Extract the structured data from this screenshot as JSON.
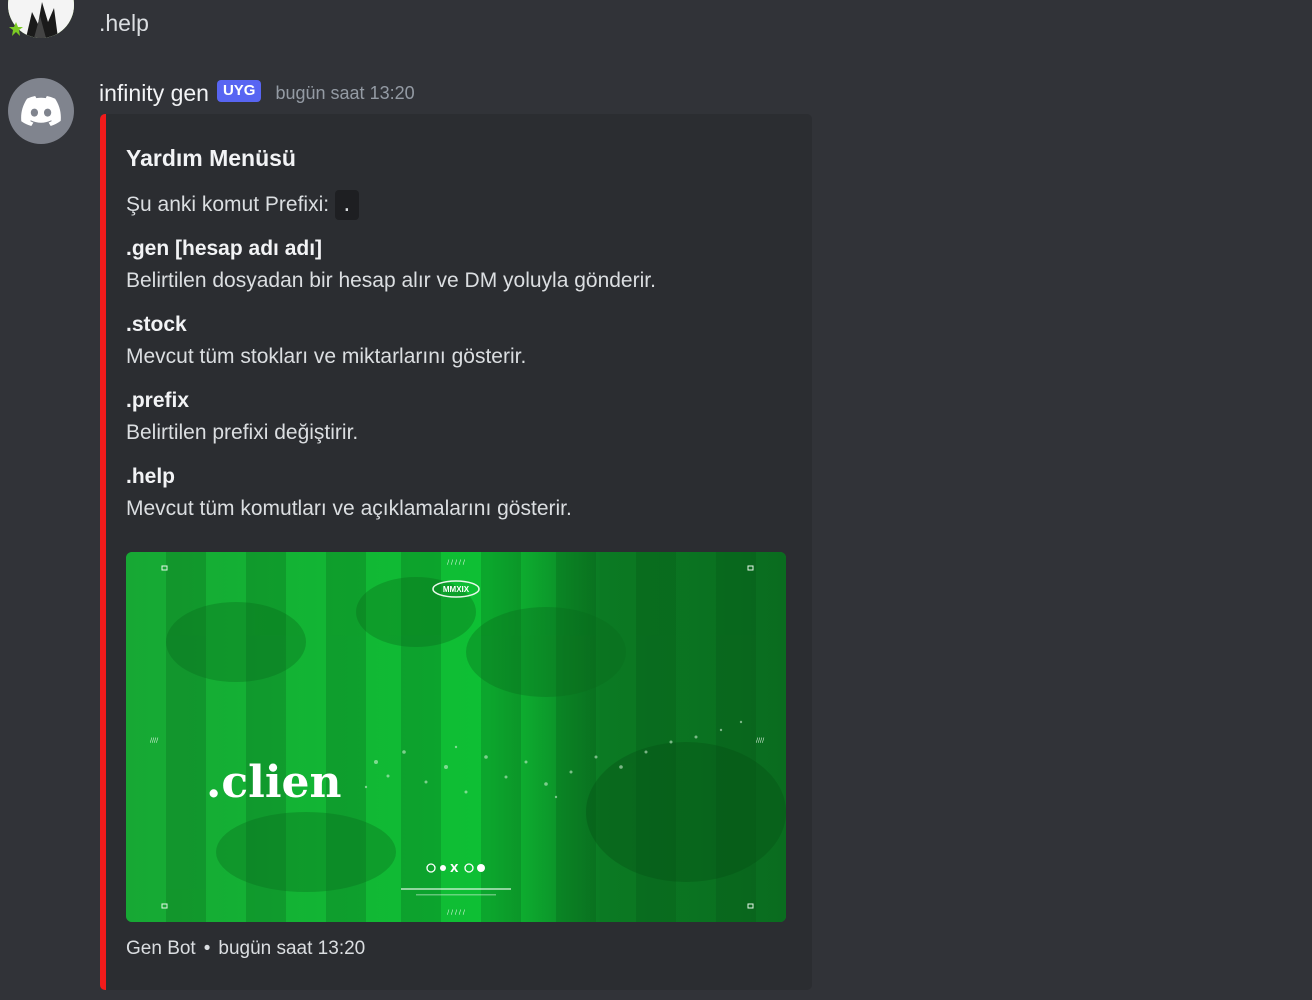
{
  "previous_message": {
    "text": ".help"
  },
  "message": {
    "author": "infinity gen",
    "badge": "UYG",
    "timestamp": "bugün saat 13:20"
  },
  "embed": {
    "accent_color": "#f21b1b",
    "title": "Yardım Menüsü",
    "description_label": "Şu anki komut Prefixi:",
    "prefix_code": ".",
    "fields": [
      {
        "name": ".gen [hesap adı adı]",
        "value": "Belirtilen dosyadan bir hesap alır ve DM yoluyla gönderir."
      },
      {
        "name": ".stock",
        "value": "Mevcut tüm stokları ve miktarlarını gösterir."
      },
      {
        "name": ".prefix",
        "value": "Belirtilen prefixi değiştirir."
      },
      {
        "name": ".help",
        "value": "Mevcut tüm komutları ve açıklamalarını gösterir."
      }
    ],
    "image": {
      "brand_text": ".clien",
      "badge_text": "MMXIX"
    },
    "footer": {
      "name": "Gen Bot",
      "separator": "•",
      "timestamp": "bugün saat 13:20"
    }
  },
  "icons": {
    "bot_avatar": "discord-logo-icon",
    "user_avatar": "user-avatar-image"
  }
}
